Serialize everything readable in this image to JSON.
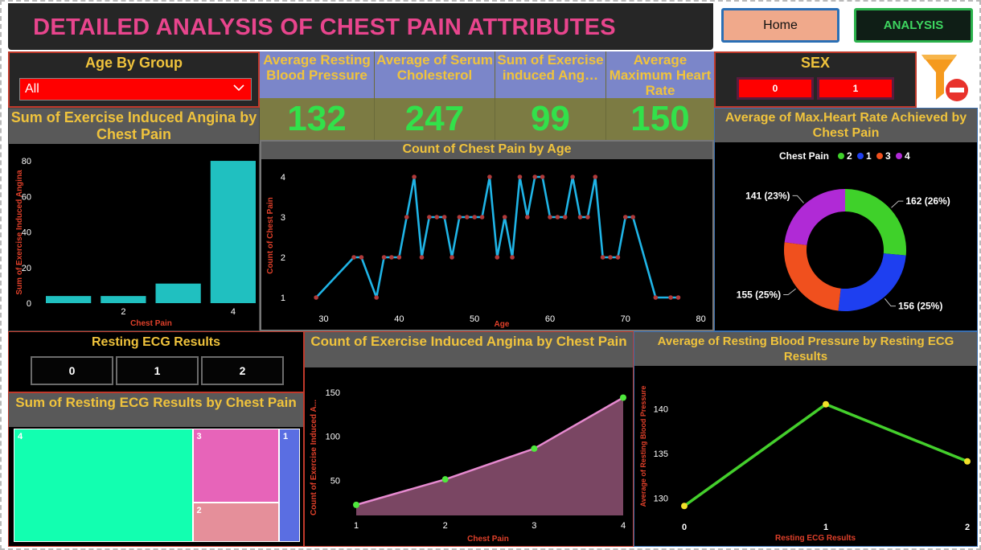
{
  "header": {
    "title": "DETAILED ANALYSIS OF CHEST PAIN  ATTRIBUTES"
  },
  "nav": {
    "home_label": "Home",
    "analysis_label": "ANALYSIS"
  },
  "age_slicer": {
    "label": "Age By Group",
    "selected": "All"
  },
  "sex_slicer": {
    "label": "SEX",
    "options": [
      "0",
      "1"
    ]
  },
  "kpis": [
    {
      "label": "Average Resting Blood Pressure",
      "value": "132"
    },
    {
      "label": "Average of Serum Cholesterol",
      "value": "247"
    },
    {
      "label": "Sum of Exercise induced Ang…",
      "value": "99"
    },
    {
      "label": "Average Maximum Heart Rate",
      "value": "150"
    }
  ],
  "ecg_slicer": {
    "label": "Resting ECG Results",
    "options": [
      "0",
      "1",
      "2"
    ]
  },
  "colors": {
    "kpi_value": "#32e14a",
    "title": "#f0c33c",
    "accent_red": "#ff0000"
  },
  "icons": {
    "filter": "filter-clear-icon",
    "dropdown": "chevron-down-icon"
  },
  "chart_data": [
    {
      "id": "bar",
      "type": "bar",
      "title": "Sum of Exercise Induced Angina by Chest Pain",
      "xlabel": "Chest Pain",
      "ylabel": "Sum of Exercise Induced Angina",
      "categories": [
        "1",
        "2",
        "3",
        "4"
      ],
      "x_tick_labels": [
        "",
        "2",
        "",
        "4"
      ],
      "values": [
        4,
        4,
        11,
        80
      ],
      "ylim": [
        0,
        85
      ],
      "yticks": [
        0,
        20,
        40,
        60,
        80
      ],
      "color": "#20c0c0"
    },
    {
      "id": "line_age",
      "type": "line",
      "title": "Count of Chest Pain by Age",
      "xlabel": "Age",
      "ylabel": "Count of Chest Pain",
      "xlim": [
        26,
        81
      ],
      "ylim": [
        0.8,
        4.2
      ],
      "xticks": [
        30,
        40,
        50,
        60,
        70,
        80
      ],
      "yticks": [
        1,
        2,
        3,
        4
      ],
      "x": [
        29,
        34,
        35,
        37,
        38,
        39,
        40,
        41,
        42,
        43,
        44,
        45,
        46,
        47,
        48,
        49,
        50,
        51,
        52,
        53,
        54,
        55,
        56,
        57,
        58,
        59,
        60,
        61,
        62,
        63,
        64,
        65,
        66,
        67,
        68,
        69,
        70,
        71,
        74,
        76,
        77
      ],
      "y": [
        1,
        2,
        2,
        1,
        2,
        2,
        2,
        3,
        4,
        2,
        3,
        3,
        3,
        2,
        3,
        3,
        3,
        3,
        4,
        2,
        3,
        2,
        4,
        3,
        4,
        4,
        3,
        3,
        3,
        4,
        3,
        3,
        4,
        2,
        2,
        2,
        3,
        3,
        1,
        1,
        1
      ],
      "line_color": "#1fb4e6",
      "marker_color": "#b03a3a"
    },
    {
      "id": "donut",
      "type": "pie",
      "title": "Average of Max.Heart Rate Achieved by Chest Pain",
      "legend_title": "Chest Pain",
      "legend_position": "top",
      "slices": [
        {
          "name": "2",
          "value": 162,
          "label": "162 (26%)",
          "color": "#3fd12a"
        },
        {
          "name": "1",
          "value": 156,
          "label": "156 (25%)",
          "color": "#1e3ff0"
        },
        {
          "name": "3",
          "value": 155,
          "label": "155 (25%)",
          "color": "#f0501e"
        },
        {
          "name": "4",
          "value": 141,
          "label": "141 (23%)",
          "color": "#b02ad6"
        }
      ]
    },
    {
      "id": "tree",
      "type": "treemap",
      "title": "Sum of Resting ECG Results by Chest Pain",
      "cells": [
        {
          "name": "4",
          "value": 60,
          "color": "#12ffb0"
        },
        {
          "name": "3",
          "value": 19,
          "color": "#e764b9"
        },
        {
          "name": "2",
          "value": 10,
          "color": "#e58f9a"
        },
        {
          "name": "1",
          "value": 7,
          "color": "#5a6ee2"
        }
      ]
    },
    {
      "id": "area",
      "type": "area",
      "title": "Count of Exercise Induced Angina by Chest Pain",
      "xlabel": "Chest Pain",
      "ylabel": "Count of Exercise Induced A...",
      "categories": [
        "1",
        "2",
        "3",
        "4"
      ],
      "values": [
        22,
        51,
        86,
        144
      ],
      "ylim": [
        10,
        160
      ],
      "yticks": [
        50,
        100,
        150
      ],
      "line_color": "#e78ad0",
      "fill_color": "#7a4663",
      "marker_color": "#4ee83c"
    },
    {
      "id": "ecg_line",
      "type": "line",
      "title": "Average of Resting Blood Pressure by Resting ECG Results",
      "xlabel": "Resting ECG Results",
      "ylabel": "Average of Resting Blood Pressure",
      "categories": [
        "0",
        "1",
        "2"
      ],
      "values": [
        129.1,
        140.5,
        134.1
      ],
      "ylim": [
        127.5,
        143
      ],
      "yticks": [
        130,
        135,
        140
      ],
      "line_color": "#44cf2c",
      "marker_color": "#f2e12a"
    }
  ]
}
